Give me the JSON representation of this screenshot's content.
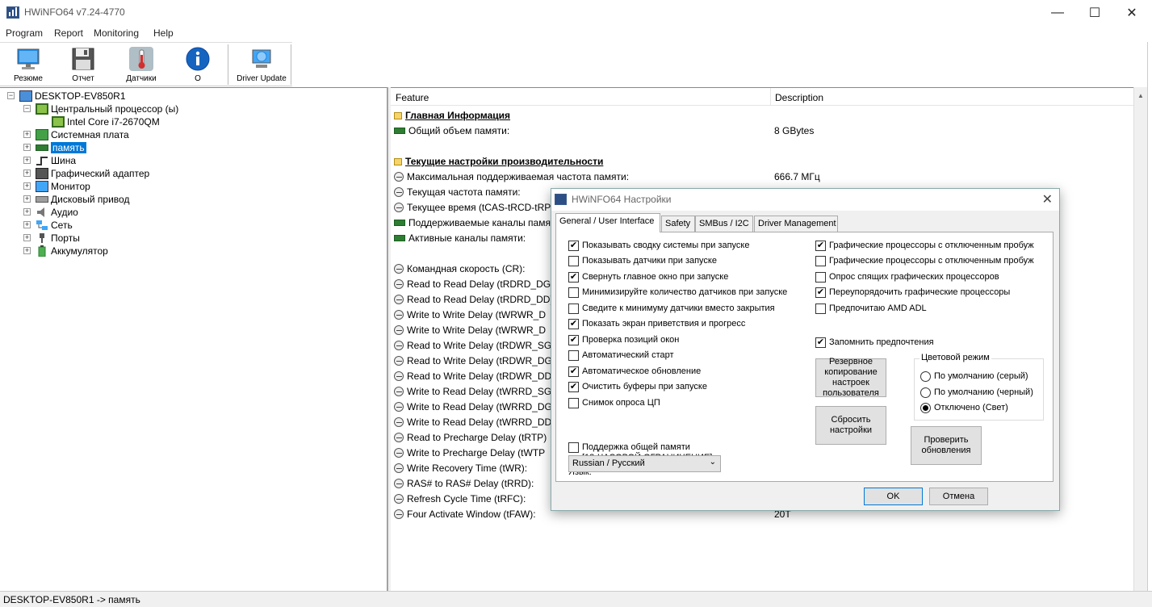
{
  "window": {
    "title": "HWiNFO64 v7.24-4770"
  },
  "menu": [
    "Program",
    "Report",
    "Monitoring",
    "Help"
  ],
  "toolbar": [
    {
      "label": "Резюме",
      "icon": "monitor-icon"
    },
    {
      "label": "Отчет",
      "icon": "floppy-disk-icon"
    },
    {
      "label": "Датчики",
      "icon": "thermometer-icon"
    },
    {
      "label": "О",
      "icon": "info-icon"
    },
    {
      "label": "Driver Update",
      "icon": "driver-update-icon"
    }
  ],
  "tree": {
    "root": "DESKTOP-EV850R1",
    "items": [
      {
        "label": "Центральный процессор (ы)",
        "icon": "cpu-icon"
      },
      {
        "label": "Intel Core i7-2670QM",
        "icon": "cpu-icon"
      },
      {
        "label": "Системная плата",
        "icon": "motherboard-icon"
      },
      {
        "label": "память",
        "icon": "memory-icon"
      },
      {
        "label": "Шина",
        "icon": "bus-icon"
      },
      {
        "label": "Графический адаптер",
        "icon": "gpu-icon"
      },
      {
        "label": "Монитор",
        "icon": "monitor-icon"
      },
      {
        "label": "Дисковый привод",
        "icon": "disk-drive-icon"
      },
      {
        "label": "Аудио",
        "icon": "audio-icon"
      },
      {
        "label": "Сеть",
        "icon": "network-icon"
      },
      {
        "label": "Порты",
        "icon": "ports-icon"
      },
      {
        "label": "Аккумулятор",
        "icon": "battery-icon"
      }
    ]
  },
  "details": {
    "col_feature": "Feature",
    "col_description": "Description",
    "rows": [
      {
        "type": "section",
        "feature": "Главная Информация",
        "value": ""
      },
      {
        "type": "ram",
        "feature": "Общий объем памяти:",
        "value": "8 GBytes"
      },
      {
        "type": "section",
        "feature": "Текущие настройки производительности",
        "value": ""
      },
      {
        "type": "clock",
        "feature": "Максимальная поддерживаемая частота памяти:",
        "value": "666.7 МГц"
      },
      {
        "type": "clock",
        "feature": "Текущая частота памяти:",
        "value": ""
      },
      {
        "type": "clock",
        "feature": "Текущее время (tCAS-tRCD-tRP",
        "value": ""
      },
      {
        "type": "ram",
        "feature": "Поддерживаемые каналы памя",
        "value": ""
      },
      {
        "type": "ram",
        "feature": "Активные каналы памяти:",
        "value": ""
      },
      {
        "type": "clock",
        "feature": "Командная скорость (CR):",
        "value": ""
      },
      {
        "type": "clock",
        "feature": "Read to Read Delay (tRDRD_DG/",
        "value": ""
      },
      {
        "type": "clock",
        "feature": "Read to Read Delay (tRDRD_DD)",
        "value": ""
      },
      {
        "type": "clock",
        "feature": "Write to Write Delay (tWRWR_D",
        "value": ""
      },
      {
        "type": "clock",
        "feature": "Write to Write Delay (tWRWR_D",
        "value": ""
      },
      {
        "type": "clock",
        "feature": "Read to Write Delay (tRDWR_SG",
        "value": ""
      },
      {
        "type": "clock",
        "feature": "Read to Write Delay (tRDWR_DG",
        "value": ""
      },
      {
        "type": "clock",
        "feature": "Read to Write Delay (tRDWR_DD",
        "value": ""
      },
      {
        "type": "clock",
        "feature": "Write to Read Delay (tWRRD_SG",
        "value": ""
      },
      {
        "type": "clock",
        "feature": "Write to Read Delay (tWRRD_DG",
        "value": ""
      },
      {
        "type": "clock",
        "feature": "Write to Read Delay (tWRRD_DD",
        "value": ""
      },
      {
        "type": "clock",
        "feature": "Read to Precharge Delay (tRTP)",
        "value": ""
      },
      {
        "type": "clock",
        "feature": "Write to Precharge Delay (tWTP",
        "value": ""
      },
      {
        "type": "clock",
        "feature": "Write Recovery Time (tWR):",
        "value": ""
      },
      {
        "type": "clock",
        "feature": "RAS# to RAS# Delay (tRRD):",
        "value": ""
      },
      {
        "type": "clock",
        "feature": "Refresh Cycle Time (tRFC):",
        "value": ""
      },
      {
        "type": "clock",
        "feature": "Four Activate Window (tFAW):",
        "value": "20T"
      }
    ]
  },
  "status": "DESKTOP-EV850R1 -> память",
  "dialog": {
    "title": "HWiNFO64 Настройки",
    "tabs": [
      "General / User Interface",
      "Safety",
      "SMBus / I2C",
      "Driver Management"
    ],
    "left_options": [
      {
        "label": "Показывать сводку системы при запуске",
        "checked": true
      },
      {
        "label": "Показывать датчики при запуске",
        "checked": false
      },
      {
        "label": "Свернуть главное окно при запуске",
        "checked": true
      },
      {
        "label": "Минимизируйте количество датчиков при запуске",
        "checked": false
      },
      {
        "label": "Сведите к минимуму датчики вместо закрытия",
        "checked": false
      },
      {
        "label": "Показать экран приветствия и прогресс",
        "checked": true
      },
      {
        "label": "Проверка позиций окон",
        "checked": true
      },
      {
        "label": "Автоматический старт",
        "checked": false
      },
      {
        "label": "Автоматическое обновление",
        "checked": true
      },
      {
        "label": "Очистить буферы при запуске",
        "checked": true
      },
      {
        "label": "Снимок опроса ЦП",
        "checked": false
      }
    ],
    "shared_memory": {
      "line1": "Поддержка общей памяти",
      "line2": "[12-ЧАСОВОЙ ОГРАНИЧЕНИЕ]",
      "checked": false
    },
    "right_options": [
      {
        "label": "Графические процессоры с отключенным пробуж",
        "checked": true
      },
      {
        "label": "Графические процессоры с отключенным пробуж",
        "checked": false
      },
      {
        "label": "Опрос спящих графических процессоров",
        "checked": false
      },
      {
        "label": "Переупорядочить графические процессоры",
        "checked": true
      },
      {
        "label": "Предпочитаю AMD ADL",
        "checked": false
      }
    ],
    "remember": {
      "label": "Запомнить предпочтения",
      "checked": true
    },
    "backup_button": "Резервное копирование настроек пользователя",
    "reset_button": "Сбросить настройки",
    "check_updates_button": "Проверить обновления",
    "color_mode": {
      "title": "Цветовой режим",
      "options": [
        "По умолчанию (серый)",
        "По умолчанию (черный)",
        "Отключено (Свет)"
      ],
      "selected": 2
    },
    "language_label": "Язык:",
    "language_value": "Russian / Русский",
    "ok": "OK",
    "cancel": "Отмена"
  }
}
